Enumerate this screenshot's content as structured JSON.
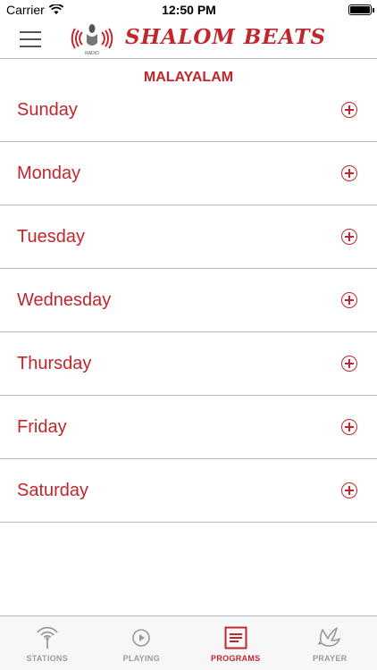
{
  "status_bar": {
    "carrier": "Carrier",
    "time": "12:50 PM"
  },
  "header": {
    "logo_badge": "RADIO",
    "title": "SHALOM BEATS",
    "menu_icon": "hamburger-menu-icon"
  },
  "section": {
    "title": "MALAYALAM"
  },
  "days": [
    {
      "label": "Sunday"
    },
    {
      "label": "Monday"
    },
    {
      "label": "Tuesday"
    },
    {
      "label": "Wednesday"
    },
    {
      "label": "Thursday"
    },
    {
      "label": "Friday"
    },
    {
      "label": "Saturday"
    }
  ],
  "expand_icon": "plus-circle-icon",
  "tabs": [
    {
      "label": "STATIONS",
      "icon": "broadcast-antenna-icon",
      "active": false
    },
    {
      "label": "PLAYING",
      "icon": "play-circle-icon",
      "active": false
    },
    {
      "label": "PROGRAMS",
      "icon": "program-list-icon",
      "active": true
    },
    {
      "label": "PRAYER",
      "icon": "dove-icon",
      "active": false
    }
  ],
  "colors": {
    "brand": "#c0272d",
    "inactive": "#9a9a9a",
    "divider": "#b8b8b8"
  }
}
